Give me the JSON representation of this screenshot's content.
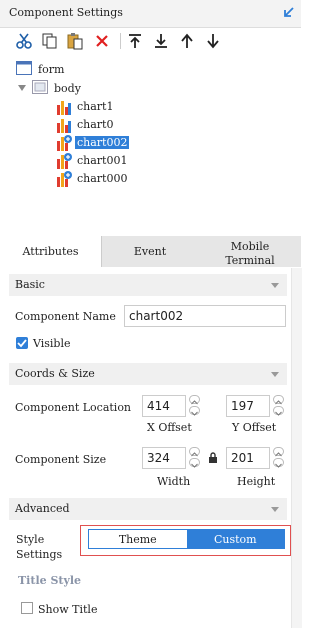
{
  "panel": {
    "title": "Component Settings"
  },
  "toolbar": {
    "items": [
      {
        "name": "cut-icon"
      },
      {
        "name": "copy-icon"
      },
      {
        "name": "paste-icon"
      },
      {
        "name": "delete-icon"
      },
      {
        "name": "move-top-icon"
      },
      {
        "name": "move-bottom-icon"
      },
      {
        "name": "move-up-icon"
      },
      {
        "name": "move-down-icon"
      }
    ]
  },
  "tree": {
    "form": "form",
    "body": "body",
    "charts": [
      "chart1",
      "chart0",
      "chart002",
      "chart001",
      "chart000"
    ],
    "selected": "chart002"
  },
  "tabs": [
    "Attributes",
    "Event",
    "Mobile Terminal"
  ],
  "basic": {
    "header": "Basic",
    "component_name_label": "Component Name",
    "component_name_value": "chart002",
    "visible_label": "Visible",
    "visible_checked": true
  },
  "coords": {
    "header": "Coords & Size",
    "location_label": "Component Location",
    "x_offset": "414",
    "y_offset": "197",
    "x_offset_label": "X Offset",
    "y_offset_label": "Y Offset",
    "size_label": "Component Size",
    "width": "324",
    "height": "201",
    "width_label": "Width",
    "height_label": "Height"
  },
  "advanced": {
    "header": "Advanced",
    "style_settings_label": "Style Settings",
    "theme_label": "Theme",
    "custom_label": "Custom",
    "selected": "Custom",
    "title_style_label": "Title Style",
    "show_title_label": "Show Title",
    "show_title_checked": false
  },
  "colors": {
    "accent": "#2f7fd8",
    "highlight": "#e05050"
  }
}
